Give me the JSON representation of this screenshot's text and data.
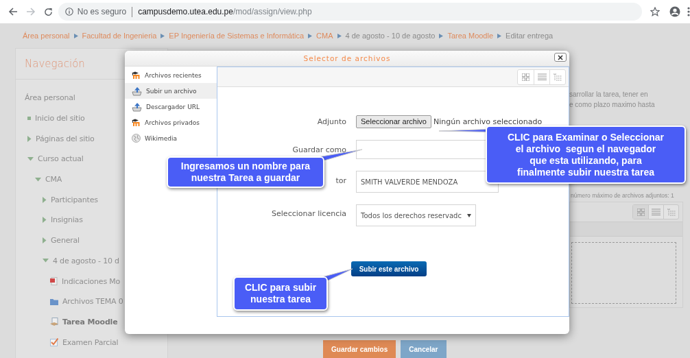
{
  "browser": {
    "security": "No es seguro",
    "url_host": "campusdemo.utea.edu.pe",
    "url_path": "/mod/assign/view.php"
  },
  "breadcrumb": [
    {
      "label": "Área personal",
      "link": true
    },
    {
      "label": "Facultad de Ingenieria",
      "link": true
    },
    {
      "label": "EP Ingeniería de Sistemas e Informática",
      "link": true
    },
    {
      "label": "CMA",
      "link": true
    },
    {
      "label": "4 de agosto - 10 de agosto",
      "link": false
    },
    {
      "label": "Tarea Moodle",
      "link": true
    },
    {
      "label": "Editar entrega",
      "link": false
    }
  ],
  "navigation": {
    "title": "Navegación",
    "items": [
      {
        "label": "Área personal",
        "kind": "heading"
      },
      {
        "label": "Inicio del sitio",
        "kind": "bullet"
      },
      {
        "label": "Páginas del sitio",
        "kind": "branch",
        "expanded": false
      },
      {
        "label": "Curso actual",
        "kind": "branch",
        "expanded": true,
        "children": [
          {
            "label": "CMA",
            "kind": "branch",
            "expanded": true,
            "children": [
              {
                "label": "Participantes",
                "kind": "branch",
                "expanded": false
              },
              {
                "label": "Insignias",
                "kind": "branch",
                "expanded": false
              },
              {
                "label": "General",
                "kind": "branch",
                "expanded": false
              },
              {
                "label": "4 de agosto - 10 d",
                "kind": "branch",
                "expanded": true,
                "children": [
                  {
                    "label": "Indicaciones Mo",
                    "kind": "pdf",
                    "selected": false
                  },
                  {
                    "label": "Archivos TEMA 0",
                    "kind": "folder",
                    "selected": false
                  },
                  {
                    "label": "Tarea Moodle",
                    "kind": "assign",
                    "selected": true
                  },
                  {
                    "label": "Examen Parcial",
                    "kind": "quiz",
                    "selected": false
                  }
                ]
              }
            ]
          }
        ]
      }
    ]
  },
  "content": {
    "description_lines": [
      "sarrollar la tarea, tener en",
      "e como plazo maximo hasta"
    ],
    "attachments_note": "número máximo de archivos adjuntos: 1",
    "buttons": [
      {
        "label": "Guardar cambios",
        "kind": "primary"
      },
      {
        "label": "Cancelar",
        "kind": "secondary"
      }
    ]
  },
  "file_picker": {
    "title": "Selector de archivos",
    "repositories": [
      {
        "label": "Archivos recientes",
        "kind": "moodle",
        "selected": false
      },
      {
        "label": "Subir un archivo",
        "kind": "upload",
        "selected": true
      },
      {
        "label": "Descargador URL",
        "kind": "upload",
        "selected": false
      },
      {
        "label": "Archivos privados",
        "kind": "moodle",
        "selected": false
      },
      {
        "label": "Wikimedia",
        "kind": "globe",
        "selected": false
      }
    ],
    "form": {
      "attachment_label": "Adjunto",
      "choose_button": "Seleccionar archivo",
      "no_file": "Ningún archivo seleccionado",
      "save_as_label": "Guardar como",
      "author_label": "tor",
      "author_value": "SMITH VALVERDE MENDOZA",
      "license_label": "Seleccionar licencia",
      "license_value": "Todos los derechos reservadc",
      "submit": "Subir este archivo"
    }
  },
  "callouts": [
    {
      "text": "Ingresamos un nombre para\nnuestra Tarea a guardar"
    },
    {
      "text": "CLIC para Examinar o Seleccionar\nel archivo  segun el navegador\nque esta utilizando, para\nfinalmente subir nuestra tarea"
    },
    {
      "text": "CLIC para subir\nnuestra tarea"
    }
  ]
}
